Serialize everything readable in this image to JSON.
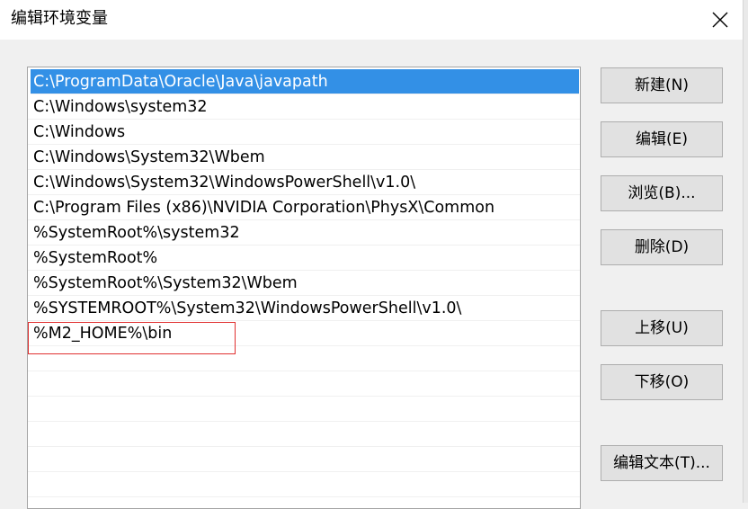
{
  "window": {
    "title": "编辑环境变量",
    "close_glyph": "close-icon"
  },
  "paths": [
    {
      "value": "C:\\ProgramData\\Oracle\\Java\\javapath",
      "selected": true
    },
    {
      "value": "C:\\Windows\\system32",
      "selected": false
    },
    {
      "value": "C:\\Windows",
      "selected": false
    },
    {
      "value": "C:\\Windows\\System32\\Wbem",
      "selected": false
    },
    {
      "value": "C:\\Windows\\System32\\WindowsPowerShell\\v1.0\\",
      "selected": false
    },
    {
      "value": "C:\\Program Files (x86)\\NVIDIA Corporation\\PhysX\\Common",
      "selected": false
    },
    {
      "value": "%SystemRoot%\\system32",
      "selected": false
    },
    {
      "value": "%SystemRoot%",
      "selected": false
    },
    {
      "value": "%SystemRoot%\\System32\\Wbem",
      "selected": false
    },
    {
      "value": "%SYSTEMROOT%\\System32\\WindowsPowerShell\\v1.0\\",
      "selected": false
    },
    {
      "value": "%M2_HOME%\\bin",
      "selected": false,
      "highlighted": true
    }
  ],
  "buttons": {
    "new": "新建(N)",
    "edit": "编辑(E)",
    "browse": "浏览(B)...",
    "delete": "删除(D)",
    "move_up": "上移(U)",
    "move_down": "下移(O)",
    "edit_text": "编辑文本(T)..."
  },
  "colors": {
    "selection": "#3390e6",
    "highlight_box": "#e03030"
  }
}
